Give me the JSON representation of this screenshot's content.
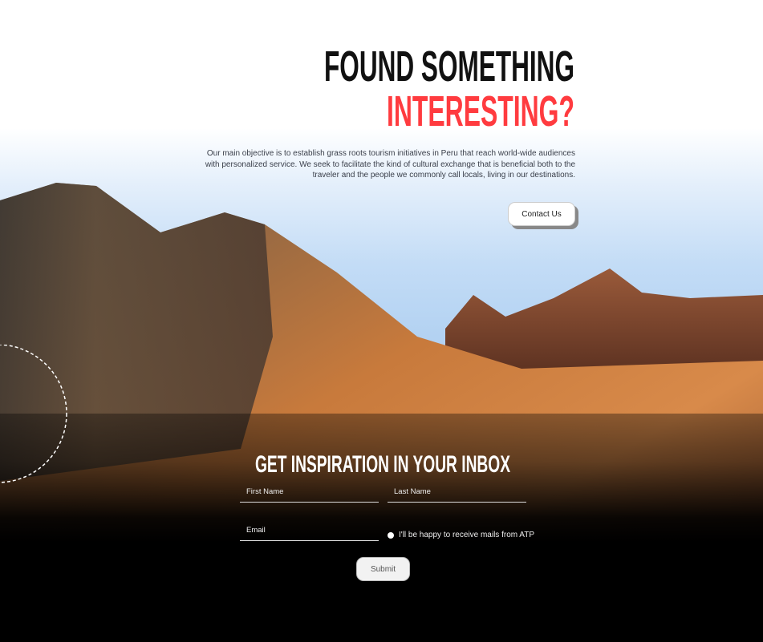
{
  "hero": {
    "title_line1": "FOUND SOMETHING",
    "title_line2": "INTERESTING?",
    "description": "Our main objective is to establish grass roots tourism initiatives in Peru that reach world-wide audiences with personalized service. We seek to facilitate the kind of cultural exchange that is beneficial both to the traveler and the people we commonly call locals, living in our destinations.",
    "contact_label": "Contact Us",
    "accent_color": "#ff3b3f"
  },
  "newsletter": {
    "title": "GET INSPIRATION IN YOUR INBOX",
    "first_name_placeholder": "First Name",
    "last_name_placeholder": "Last Name",
    "email_placeholder": "Email",
    "consent_label": "I'll be happy to receive mails from ATP",
    "submit_label": "Submit"
  }
}
